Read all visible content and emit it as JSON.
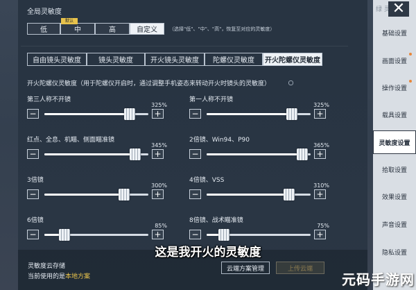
{
  "global": {
    "title": "全局灵敏度",
    "levels": [
      "低",
      "中",
      "高",
      "自定义"
    ],
    "default_tag": "默认",
    "hint": "（选择\"低\"、\"中\"、\"高\"，恢复至对应的灵敏度）"
  },
  "tabs": [
    "自由镜头灵敏度",
    "镜头灵敏度",
    "开火镜头灵敏度",
    "陀螺仪灵敏度",
    "开火陀螺仪灵敏度"
  ],
  "section": {
    "title": "开火陀螺仪灵敏度（用于陀螺仪开启时，通过调整手机姿态来转动开火时镜头的灵敏度）"
  },
  "sliders": [
    {
      "label": "第三人称不开镜",
      "percent": "325%",
      "value": 0.86
    },
    {
      "label": "第一人称不开镜",
      "percent": "325%",
      "value": 0.86
    },
    {
      "label": "红点、全息、机瞄、侧面瞄准镜",
      "percent": "345%",
      "value": 0.92
    },
    {
      "label": "2倍镜、Win94、P90",
      "percent": "365%",
      "value": 0.97
    },
    {
      "label": "3倍镜",
      "percent": "300%",
      "value": 0.8
    },
    {
      "label": "4倍镜、VSS",
      "percent": "310%",
      "value": 0.83
    },
    {
      "label": "6倍镜",
      "percent": "85%",
      "value": 0.16
    },
    {
      "label": "8倍镜、战术瞄准镜",
      "percent": "75%",
      "value": 0.13
    }
  ],
  "stepper": {
    "minus": "−",
    "plus": "+"
  },
  "cloud": {
    "title": "灵敏度云存储",
    "current_prefix": "当前使用的是",
    "current_value": "本地方案",
    "manage_button": "云端方案管理",
    "upload_button": "上传云端"
  },
  "sidebar": {
    "top_partial": "绿 灵",
    "items": [
      "基础设置",
      "画面设置",
      "操作设置",
      "载具设置",
      "灵敏度设置",
      "拾取设置",
      "效果设置",
      "声音设置",
      "隐私设置"
    ],
    "active_index": 4
  },
  "close_icon": "✕",
  "subtitle": "这是我开火的灵敏度",
  "watermark": "元码手游网",
  "colors": {
    "accent_yellow": "#e8c34c",
    "panel_bg": "#263240",
    "selected_bg": "#eef2f6"
  }
}
